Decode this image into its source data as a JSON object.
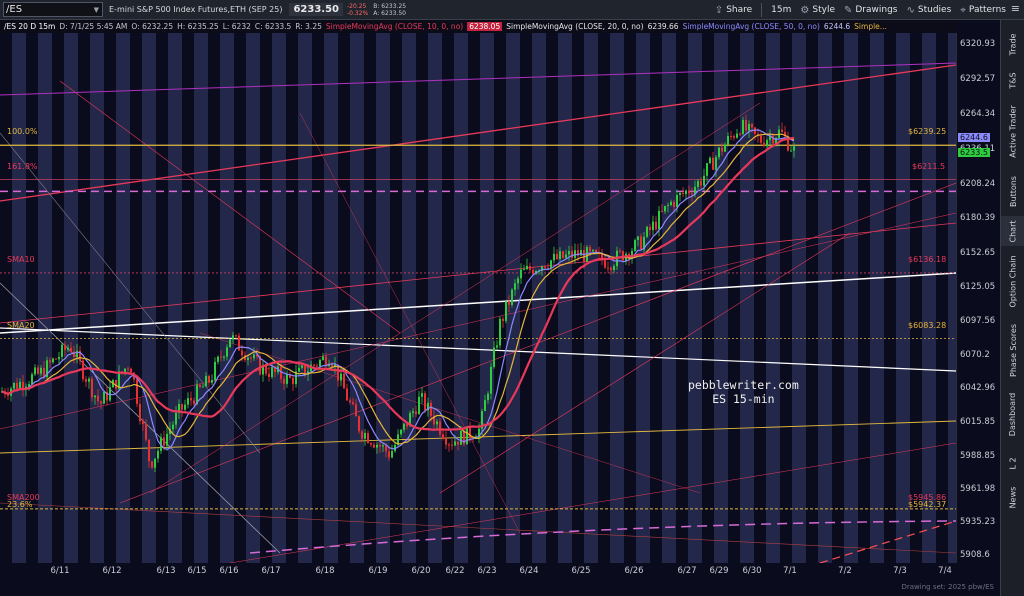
{
  "toolbar": {
    "symbol": "/ES",
    "title": "E-mini S&P 500 Index Futures,ETH (SEP 25)",
    "last_price": "6233.50",
    "change": "-20.25",
    "change_pct": "-0.32%",
    "bid": "B: 6233.25",
    "ask": "A: 6233.50",
    "share": "Share",
    "timeframe": "15m",
    "style": "Style",
    "drawings": "Drawings",
    "studies": "Studies",
    "patterns": "Patterns"
  },
  "subbar": {
    "symbol": "/ES 20 D 15m",
    "datetime": "D: 7/1/25 5:45 AM",
    "open": "O: 6232.25",
    "high": "H: 6235.25",
    "low": "L: 6232",
    "close": "C: 6233.5",
    "range": "R: 3.25",
    "sma10_label": "SimpleMovingAvg (CLOSE, 10, 0, no)",
    "sma10_value": "6238.05",
    "sma20_label": "SimpleMovingAvg (CLOSE, 20, 0, no)",
    "sma20_value": "6239.66",
    "sma50_label": "SimpleMovingAvg (CLOSE, 50, 0, no)",
    "sma50_value": "6244.6",
    "sma200_label": "Simple..."
  },
  "yaxis": {
    "ticks": [
      "6320.93",
      "6292.57",
      "6264.34",
      "6236.11",
      "6208.24",
      "6180.39",
      "6152.65",
      "6125.05",
      "6097.56",
      "6070.2",
      "6042.96",
      "6015.85",
      "5988.85",
      "5961.98",
      "5935.23",
      "5908.6"
    ],
    "tag_sma50": "6244.6",
    "tag_last": "6233.5"
  },
  "xaxis": {
    "dates": [
      "6/11",
      "6/12",
      "6/13",
      "6/15",
      "6/16",
      "6/17",
      "6/18",
      "6/19",
      "6/20",
      "6/22",
      "6/23",
      "6/24",
      "6/25",
      "6/26",
      "6/27",
      "6/29",
      "6/30",
      "7/1",
      "7/2",
      "7/3",
      "7/4"
    ]
  },
  "levels": {
    "fib100_label": "100.0%",
    "fib100_value": "$6239.25",
    "fib1618_label": "161.8%",
    "fib1618_value": "$6211.5",
    "sma10_label": "SMA10",
    "sma10_value": "$6136.18",
    "sma20_label": "SMA20",
    "sma20_value": "$6083.28",
    "sma200_label": "SMA200",
    "sma200_value": "$5945.86",
    "fib_low_label": "23.6%",
    "fib_low_value": "$5942.37"
  },
  "watermark": {
    "line1": "pebblewriter.com",
    "line2": "ES 15-min"
  },
  "footer": {
    "drawing_note": "Drawing set: 2025 pbw/ES"
  },
  "sidebar": {
    "items": [
      "Trade",
      "T&S",
      "Active Trader",
      "Buttons",
      "Chart",
      "Option Chain",
      "Phase Scores",
      "Dashboard",
      "L 2",
      "News"
    ]
  },
  "colors": {
    "background": "#0b0b1e",
    "band": "#262a4e",
    "sma10": "#e8395a",
    "sma20": "#e5b53a",
    "sma50": "#8a8aff",
    "price_up": "#2ecc40",
    "price_down": "#e83030",
    "fib_line": "#e0b840",
    "magenta_dash": "#d66ad6"
  }
}
